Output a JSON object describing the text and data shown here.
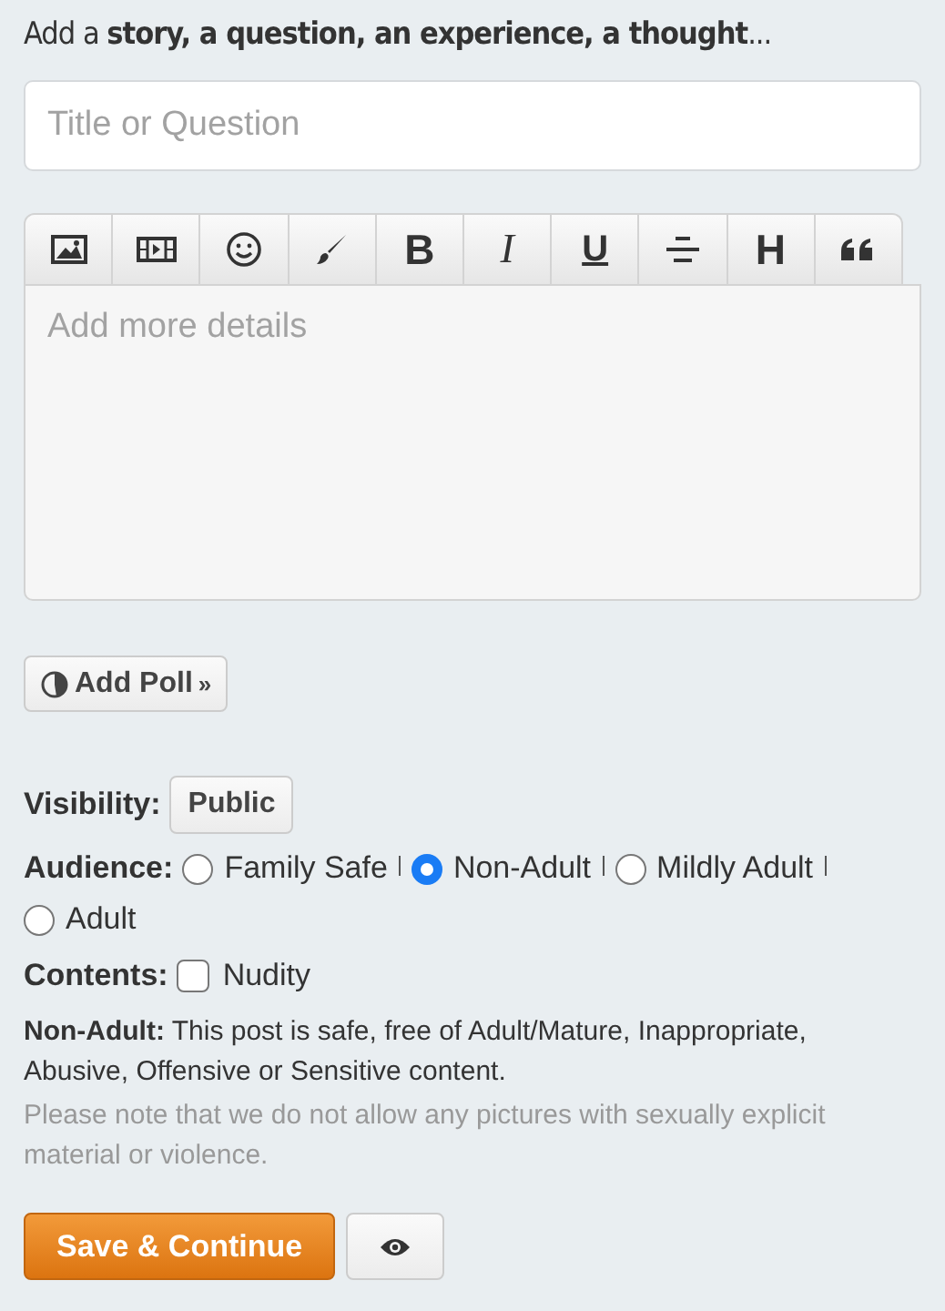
{
  "heading": "Add a **story, a question, an experience, a thought**...",
  "title_field": {
    "placeholder": "Title or Question"
  },
  "toolbar": [
    {
      "kind": "image"
    },
    {
      "kind": "video"
    },
    {
      "kind": "emoji"
    },
    {
      "kind": "brush"
    },
    {
      "kind": "bold",
      "label": "B"
    },
    {
      "kind": "italic",
      "label": "I"
    },
    {
      "kind": "underline",
      "label": "U"
    },
    {
      "kind": "align"
    },
    {
      "kind": "heading",
      "label": "H"
    },
    {
      "kind": "quote"
    }
  ],
  "details_field": {
    "placeholder": "Add more details"
  },
  "poll_button": {
    "label": "Add Poll",
    "suffix": "»"
  },
  "visibility": {
    "label": "Visibility:",
    "value": "Public"
  },
  "audience": {
    "label": "Audience:",
    "options": [
      {
        "label": "Family Safe",
        "selected": false
      },
      {
        "label": "Non-Adult",
        "selected": true
      },
      {
        "label": "Mildly Adult",
        "selected": false
      },
      {
        "label": "Adult",
        "selected": false
      }
    ]
  },
  "contents": {
    "label": "Contents:",
    "options": [
      {
        "label": "Nudity",
        "checked": false
      }
    ]
  },
  "description": "**Non-Adult:** This post is safe, free of Adult/Mature, Inappropriate, Abusive, Offensive or Sensitive content.",
  "note": "Please note that we do not allow any pictures with sexually explicit material or violence.",
  "save_button": "Save & Continue"
}
